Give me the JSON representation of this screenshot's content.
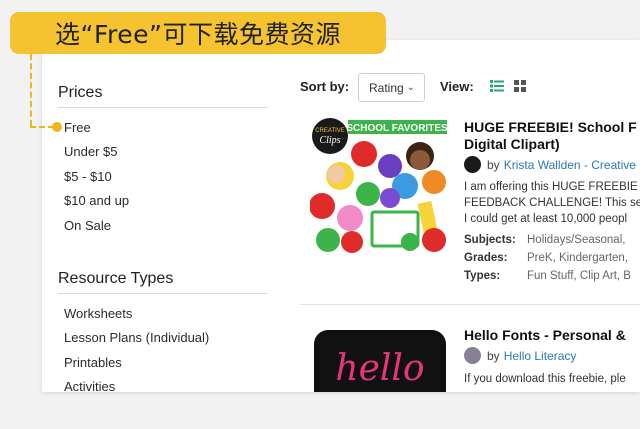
{
  "annotation": {
    "text": "选“Free”可下载免费资源"
  },
  "sidebar": {
    "prices": {
      "title": "Prices",
      "items": [
        "Free",
        "Under $5",
        "$5 - $10",
        "$10 and up",
        "On Sale"
      ]
    },
    "resource_types": {
      "title": "Resource Types",
      "items": [
        "Worksheets",
        "Lesson Plans (Individual)",
        "Printables",
        "Activities"
      ]
    }
  },
  "sortbar": {
    "sort_label": "Sort by:",
    "sort_value": "Rating",
    "view_label": "View:"
  },
  "colors": {
    "accent": "#f5c230",
    "list_icon": "#2aa37a",
    "link": "#2a7ab0"
  },
  "products": [
    {
      "title_line1": "HUGE FREEBIE! School F",
      "title_line2": "Digital Clipart)",
      "by": "by",
      "author": "Krista Wallden - Creative",
      "thumb_banner": "SCHOOL FAVORITES",
      "thumb_logo_1": "CREATIVE",
      "thumb_logo_2": "Clips",
      "desc": [
        "I am offering this HUGE FREEBIE",
        "FEEDBACK CHALLENGE! This se",
        "I could get at least 10,000 peopl"
      ],
      "meta": [
        {
          "key": "Subjects:",
          "value": "Holidays/Seasonal,"
        },
        {
          "key": "Grades:",
          "value": "PreK, Kindergarten,"
        },
        {
          "key": "Types:",
          "value": "Fun Stuff, Clip Art, B"
        }
      ]
    },
    {
      "title_line1": "Hello Fonts - Personal &",
      "by": "by",
      "author": "Hello Literacy",
      "thumb_text": "hello",
      "desc": [
        "If you download this freebie, ple"
      ]
    }
  ]
}
